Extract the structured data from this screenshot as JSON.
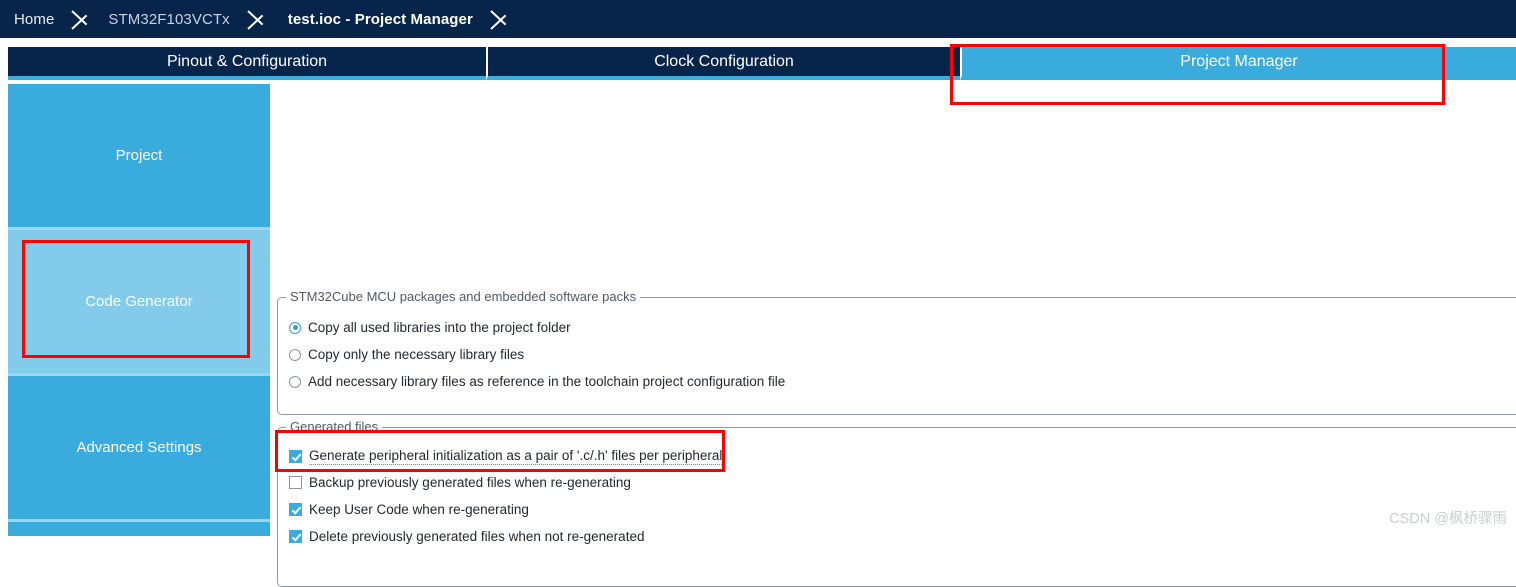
{
  "breadcrumb": {
    "items": [
      {
        "label": "Home",
        "state": "normal"
      },
      {
        "label": "STM32F103VCTx",
        "state": "normal"
      },
      {
        "label": "test.ioc - Project Manager",
        "state": "current"
      }
    ]
  },
  "tabs": [
    {
      "label": "Pinout & Configuration",
      "active": false
    },
    {
      "label": "Clock Configuration",
      "active": false
    },
    {
      "label": "Project Manager",
      "active": true
    }
  ],
  "sidebar": {
    "items": [
      {
        "label": "Project",
        "selected": false
      },
      {
        "label": "Code Generator",
        "selected": true
      },
      {
        "label": "Advanced Settings",
        "selected": false
      }
    ]
  },
  "packages_group": {
    "legend": "STM32Cube MCU packages and embedded software packs",
    "options": [
      {
        "label": "Copy all used libraries into the project folder",
        "checked": true
      },
      {
        "label": "Copy only the necessary library files",
        "checked": false
      },
      {
        "label": "Add necessary library files as reference in the toolchain project configuration file",
        "checked": false
      }
    ]
  },
  "generated_files_group": {
    "legend": "Generated files",
    "options": [
      {
        "label": "Generate peripheral initialization as a pair of '.c/.h' files per peripheral",
        "checked": true
      },
      {
        "label": "Backup previously generated files when re-generating",
        "checked": false
      },
      {
        "label": "Keep User Code when re-generating",
        "checked": true
      },
      {
        "label": "Delete previously generated files when not re-generated",
        "checked": true
      }
    ]
  },
  "annotations": {
    "color": "#fe0000",
    "targets": [
      "project-manager-tab",
      "code-generator-sidebar-item",
      "generate-peripheral-init-checkbox"
    ]
  },
  "watermark": {
    "text": "CSDN @枫桥骤雨"
  },
  "colors": {
    "header_navy": "#07244b",
    "accent_blue": "#3aabdd",
    "selected_blue": "#82cbea",
    "annotation_red": "#fe0000"
  }
}
